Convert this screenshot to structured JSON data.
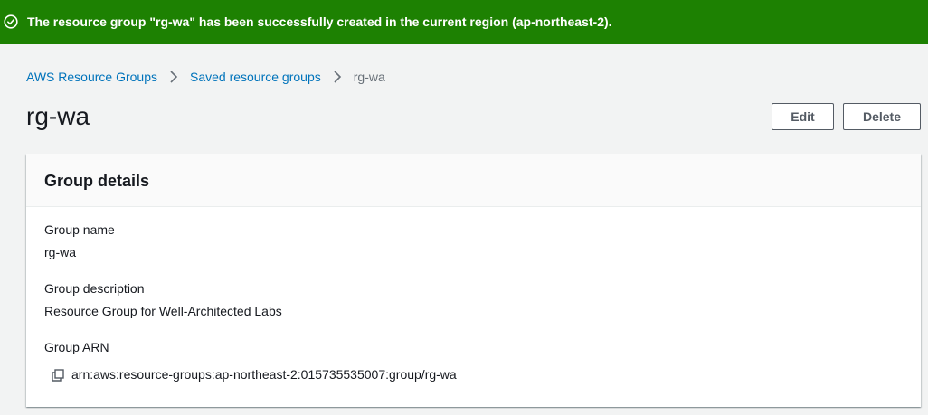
{
  "flash": {
    "icon": "success-check-icon",
    "message": "The resource group \"rg-wa\" has been successfully created in the current region (ap-northeast-2).",
    "color": "#1d8102"
  },
  "breadcrumb": {
    "items": [
      "AWS Resource Groups",
      "Saved resource groups"
    ],
    "current": "rg-wa",
    "separator_icon": "chevron-right-icon"
  },
  "page": {
    "title": "rg-wa",
    "edit_label": "Edit",
    "delete_label": "Delete"
  },
  "details": {
    "title": "Group details",
    "name_label": "Group name",
    "name_value": "rg-wa",
    "description_label": "Group description",
    "description_value": "Resource Group for Well-Architected Labs",
    "arn_label": "Group ARN",
    "arn_value": "arn:aws:resource-groups:ap-northeast-2:015735535007:group/rg-wa",
    "copy_icon": "copy-icon"
  }
}
